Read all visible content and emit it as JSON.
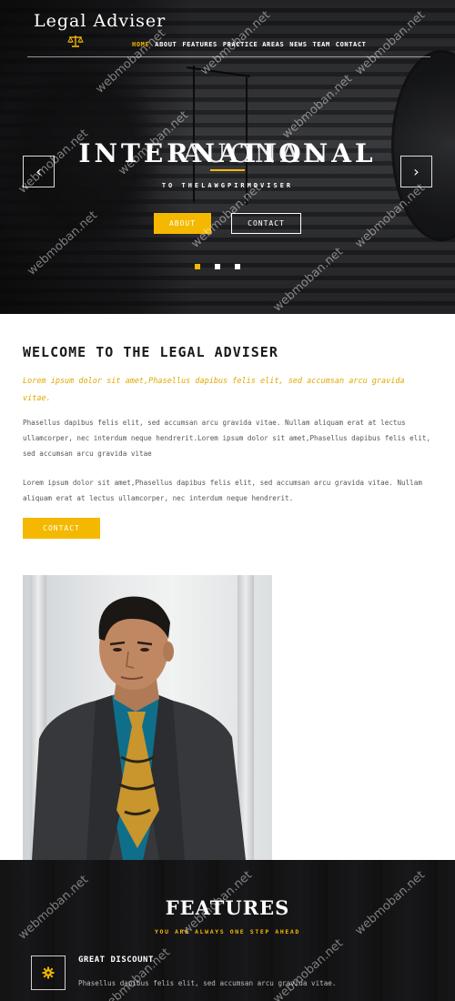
{
  "brand": {
    "name": "Legal Adviser",
    "logo_icon": "scales-icon"
  },
  "nav": {
    "items": [
      {
        "label": "HOME",
        "active": true
      },
      {
        "label": "ABOUT",
        "active": false
      },
      {
        "label": "FEATURES",
        "active": false
      },
      {
        "label": "PRACTICE AREAS",
        "active": false
      },
      {
        "label": "NEWS",
        "active": false
      },
      {
        "label": "TEAM",
        "active": false
      },
      {
        "label": "CONTACT",
        "active": false
      }
    ]
  },
  "hero": {
    "title": "INTERNATIONAL",
    "title_overlay": "AUONAL",
    "subtitle": "TO THELAWGPIRMDVISER",
    "about_label": "ABOUT",
    "contact_label": "CONTACT",
    "prev_icon": "chevron-left-icon",
    "next_icon": "chevron-right-icon",
    "slides": 3,
    "active_slide": 1
  },
  "welcome": {
    "title": "WELCOME TO THE LEGAL ADVISER",
    "lead": "Lorem ipsum dolor sit amet,Phasellus dapibus felis elit, sed accumsan arcu gravida vitae.",
    "paragraph1": "Phasellus dapibus felis elit, sed accumsan arcu gravida vitae. Nullam aliquam erat at lectus ullamcorper, nec interdum neque hendrerit.Lorem ipsum dolor sit amet,Phasellus dapibus felis elit, sed accumsan arcu gravida vitae",
    "paragraph2": "Lorem ipsum dolor sit amet,Phasellus dapibus felis elit, sed accumsan arcu gravida vitae. Nullam aliquam erat at lectus ullamcorper, nec interdum neque hendrerit.",
    "contact_label": "CONTACT"
  },
  "features": {
    "title": "FEATURES",
    "subtitle": "YOU ARE ALWAYS ONE STEP AHEAD",
    "items": [
      {
        "title": "GREAT DISCOUNT",
        "text": "Phasellus dapibus felis elit, sed accumsan arcu gravida vitae.",
        "icon": "gear-icon"
      }
    ]
  },
  "watermark": "webmoban.net",
  "colors": {
    "accent": "#f5b800",
    "dark": "#1d1d1f",
    "text": "#555555"
  }
}
